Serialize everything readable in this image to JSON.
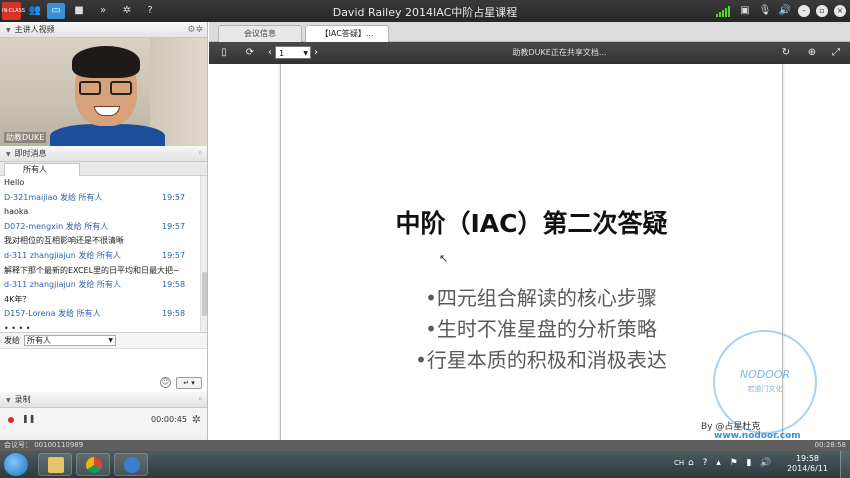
{
  "titlebar": {
    "logo_text": "IN·CLASS",
    "title": "David Railey  2014IAC中阶占星课程"
  },
  "left_panel": {
    "presenter": {
      "header": "主讲人视频",
      "name_overlay": "助教DUKE"
    },
    "chat": {
      "header": "即时消息",
      "tab_all": "所有人",
      "messages": [
        {
          "text": "Hello",
          "meta": false,
          "time": ""
        },
        {
          "text": "D-321maijiao 发给 所有人",
          "meta": true,
          "time": "19:57"
        },
        {
          "text": "haoka",
          "meta": false,
          "time": ""
        },
        {
          "text": "D072-mengxin 发给 所有人",
          "meta": true,
          "time": "19:57"
        },
        {
          "text": "我对相位的互相影响还是不很清晰",
          "meta": false,
          "time": ""
        },
        {
          "text": "d-311 zhangjiajun 发给 所有人",
          "meta": true,
          "time": "19:57"
        },
        {
          "text": "解释下那个最新的EXCEL里的日平均和日最大把~",
          "meta": false,
          "time": ""
        },
        {
          "text": "d-311 zhangjiajun 发给 所有人",
          "meta": true,
          "time": "19:58"
        },
        {
          "text": "4K年？",
          "meta": false,
          "time": ""
        },
        {
          "text": "D157-Lorena 发给 所有人",
          "meta": true,
          "time": "19:58"
        },
        {
          "text": "• • • •",
          "meta": false,
          "time": ""
        }
      ],
      "send_to_label": "发给",
      "send_to_value": "所有人"
    },
    "recording": {
      "header": "录制",
      "time": "00:00:45"
    }
  },
  "doc": {
    "tabs": [
      "会议信息",
      "【IAC答疑】..."
    ],
    "page_number": "1",
    "status_text": "助教DUKE正在共享文档...",
    "slide": {
      "title": "中阶（IAC）第二次答疑",
      "bullets": [
        "•四元组合解读的核心步骤",
        "•生时不准星盘的分析策略",
        "•行星本质的积极和消极表达"
      ],
      "byline": "By @占星杜克",
      "watermark_brand": "NODOOR",
      "watermark_sub": "若道门文化",
      "watermark_url": "www.nodoor.com"
    }
  },
  "status_strip": {
    "meeting": "会议号： 00100110989",
    "clock": "00:28:58"
  },
  "taskbar": {
    "lang": "CH",
    "time": "19:58",
    "date": "2014/6/11"
  }
}
